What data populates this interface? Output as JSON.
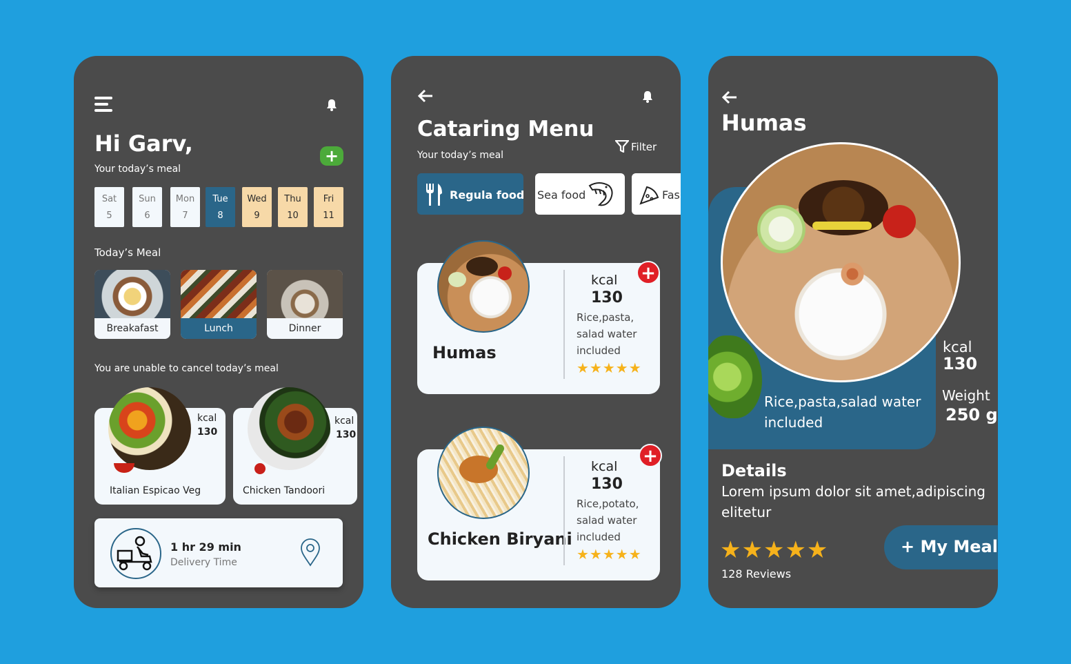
{
  "screen1": {
    "greeting": "Hi Garv,",
    "subtitle": "Your today’s meal",
    "days": [
      {
        "name": "Sat",
        "num": "5"
      },
      {
        "name": "Sun",
        "num": "6"
      },
      {
        "name": "Mon",
        "num": "7"
      },
      {
        "name": "Tue",
        "num": "8"
      },
      {
        "name": "Wed",
        "num": "9"
      },
      {
        "name": "Thu",
        "num": "10"
      },
      {
        "name": "Fri",
        "num": "11"
      }
    ],
    "todays_meal_label": "Today’s Meal",
    "meals": [
      "Breakafast",
      "Lunch",
      "Dinner"
    ],
    "cancel_notice": "You are unable to cancel today’s meal",
    "dishes": [
      {
        "name": "Italian Espicao Veg",
        "kcal_label": "kcal",
        "kcal": "130"
      },
      {
        "name": "Chicken Tandoori",
        "kcal_label": "kcal",
        "kcal": "130"
      }
    ],
    "delivery": {
      "time": "1 hr 29 min",
      "label": "Delivery Time"
    }
  },
  "screen2": {
    "title": "Cataring Menu",
    "subtitle": "Your today’s meal",
    "filter": "Filter",
    "categories": [
      "Regula food",
      "Sea food",
      "Fas"
    ],
    "items": [
      {
        "name": "Humas",
        "kcal_label": "kcal",
        "kcal": "130",
        "desc1": "Rice,pasta,",
        "desc2": "salad water",
        "desc3": "included",
        "rating": 5
      },
      {
        "name": "Chicken Biryani",
        "kcal_label": "kcal",
        "kcal": "130",
        "desc1": "Rice,potato,",
        "desc2": "salad water",
        "desc3": "included",
        "rating": 5
      }
    ]
  },
  "screen3": {
    "title": "Humas",
    "kcal_label": "kcal",
    "kcal": "130",
    "weight_label": "Weight",
    "weight": "250 g",
    "desc1": "Rice,pasta,salad water",
    "desc2": "included",
    "details_title": "Details",
    "details_line1": "Lorem ipsum dolor sit amet,adipiscing",
    "details_line2": "elitetur",
    "rating": 5,
    "reviews": "128 Reviews",
    "cta": "+ My Meal"
  },
  "colors": {
    "background": "#1f9fde",
    "card": "#4b4b4b",
    "accent_blue": "#2a6689",
    "accent_peach": "#f7d9a8",
    "green_plus": "#4caa3a",
    "red_plus": "#e01f26",
    "star": "#f6b21b"
  }
}
